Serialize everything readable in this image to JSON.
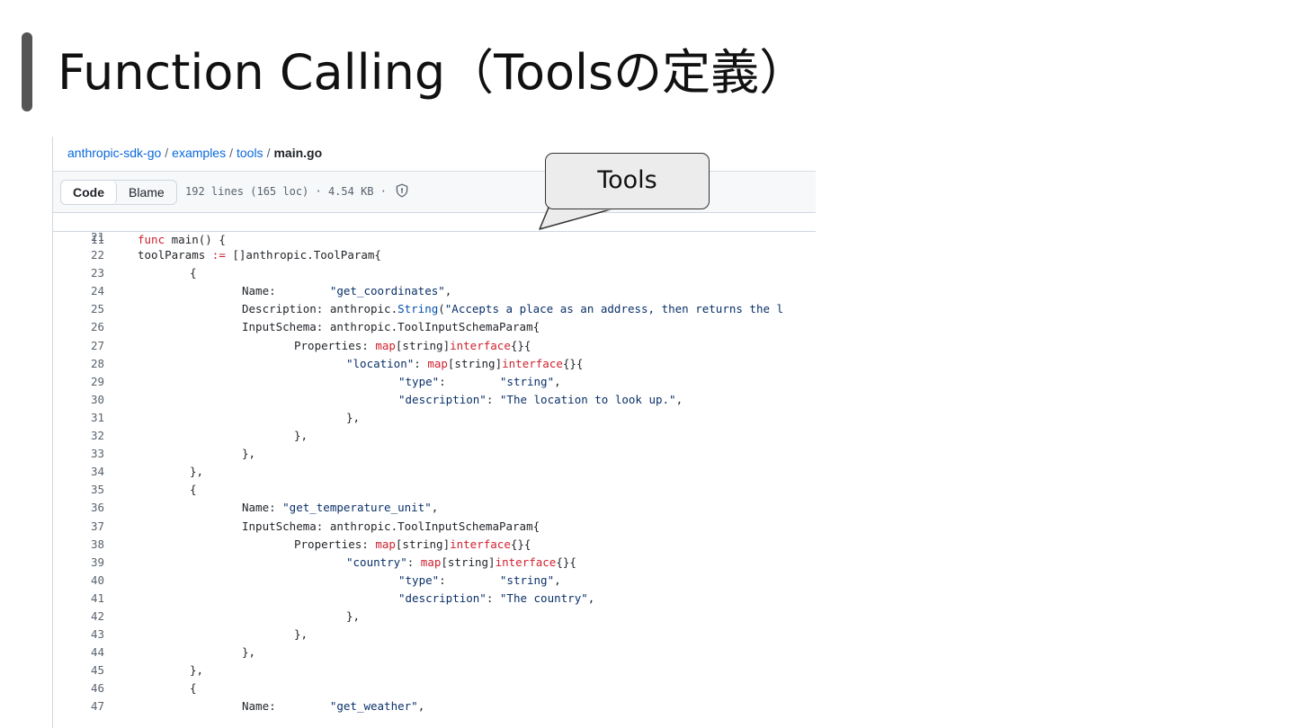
{
  "slide": {
    "title": "Function Calling（Toolsの定義）"
  },
  "callout": {
    "text": "Tools"
  },
  "breadcrumb": {
    "repo": "anthropic-sdk-go",
    "dir1": "examples",
    "dir2": "tools",
    "file": "main.go",
    "separator": "/"
  },
  "toolbar": {
    "code_label": "Code",
    "blame_label": "Blame",
    "file_meta": "192 lines (165 loc) · 4.54 KB ·",
    "shield_icon": "shield-icon"
  },
  "sticky": {
    "line": "11",
    "code": "func main() {"
  },
  "colors": {
    "link": "#0969da",
    "keyword": "#cf222e",
    "string": "#0a3069",
    "function": "#0550ae",
    "line_number": "#59636e",
    "accent_bar": "#555555"
  },
  "code_lines": [
    {
      "n": "21",
      "indent": 0,
      "tokens": []
    },
    {
      "n": "22",
      "indent": 1,
      "tokens": [
        [
          "t",
          "toolParams "
        ],
        [
          "k",
          ":="
        ],
        [
          "t",
          " []anthropic.ToolParam{"
        ]
      ]
    },
    {
      "n": "23",
      "indent": 2,
      "tokens": [
        [
          "t",
          "{"
        ]
      ]
    },
    {
      "n": "24",
      "indent": 3,
      "tokens": [
        [
          "t",
          "Name:        "
        ],
        [
          "s",
          "\"get_coordinates\""
        ],
        [
          "t",
          ","
        ]
      ]
    },
    {
      "n": "25",
      "indent": 3,
      "tokens": [
        [
          "t",
          "Description: anthropic."
        ],
        [
          "f",
          "String"
        ],
        [
          "t",
          "("
        ],
        [
          "s",
          "\"Accepts a place as an address, then returns the l"
        ]
      ]
    },
    {
      "n": "26",
      "indent": 3,
      "tokens": [
        [
          "t",
          "InputSchema: anthropic.ToolInputSchemaParam{"
        ]
      ]
    },
    {
      "n": "27",
      "indent": 4,
      "tokens": [
        [
          "t",
          "Properties: "
        ],
        [
          "k",
          "map"
        ],
        [
          "t",
          "[string]"
        ],
        [
          "k",
          "interface"
        ],
        [
          "t",
          "{}{"
        ]
      ]
    },
    {
      "n": "28",
      "indent": 5,
      "tokens": [
        [
          "s",
          "\"location\""
        ],
        [
          "t",
          ": "
        ],
        [
          "k",
          "map"
        ],
        [
          "t",
          "[string]"
        ],
        [
          "k",
          "interface"
        ],
        [
          "t",
          "{}{"
        ]
      ]
    },
    {
      "n": "29",
      "indent": 6,
      "tokens": [
        [
          "s",
          "\"type\""
        ],
        [
          "t",
          ":        "
        ],
        [
          "s",
          "\"string\""
        ],
        [
          "t",
          ","
        ]
      ]
    },
    {
      "n": "30",
      "indent": 6,
      "tokens": [
        [
          "s",
          "\"description\""
        ],
        [
          "t",
          ": "
        ],
        [
          "s",
          "\"The location to look up.\""
        ],
        [
          "t",
          ","
        ]
      ]
    },
    {
      "n": "31",
      "indent": 5,
      "tokens": [
        [
          "t",
          "},"
        ]
      ]
    },
    {
      "n": "32",
      "indent": 4,
      "tokens": [
        [
          "t",
          "},"
        ]
      ]
    },
    {
      "n": "33",
      "indent": 3,
      "tokens": [
        [
          "t",
          "},"
        ]
      ]
    },
    {
      "n": "34",
      "indent": 2,
      "tokens": [
        [
          "t",
          "},"
        ]
      ]
    },
    {
      "n": "35",
      "indent": 2,
      "tokens": [
        [
          "t",
          "{"
        ]
      ]
    },
    {
      "n": "36",
      "indent": 3,
      "tokens": [
        [
          "t",
          "Name: "
        ],
        [
          "s",
          "\"get_temperature_unit\""
        ],
        [
          "t",
          ","
        ]
      ]
    },
    {
      "n": "37",
      "indent": 3,
      "tokens": [
        [
          "t",
          "InputSchema: anthropic.ToolInputSchemaParam{"
        ]
      ]
    },
    {
      "n": "38",
      "indent": 4,
      "tokens": [
        [
          "t",
          "Properties: "
        ],
        [
          "k",
          "map"
        ],
        [
          "t",
          "[string]"
        ],
        [
          "k",
          "interface"
        ],
        [
          "t",
          "{}{"
        ]
      ]
    },
    {
      "n": "39",
      "indent": 5,
      "tokens": [
        [
          "s",
          "\"country\""
        ],
        [
          "t",
          ": "
        ],
        [
          "k",
          "map"
        ],
        [
          "t",
          "[string]"
        ],
        [
          "k",
          "interface"
        ],
        [
          "t",
          "{}{"
        ]
      ]
    },
    {
      "n": "40",
      "indent": 6,
      "tokens": [
        [
          "s",
          "\"type\""
        ],
        [
          "t",
          ":        "
        ],
        [
          "s",
          "\"string\""
        ],
        [
          "t",
          ","
        ]
      ]
    },
    {
      "n": "41",
      "indent": 6,
      "tokens": [
        [
          "s",
          "\"description\""
        ],
        [
          "t",
          ": "
        ],
        [
          "s",
          "\"The country\""
        ],
        [
          "t",
          ","
        ]
      ]
    },
    {
      "n": "42",
      "indent": 5,
      "tokens": [
        [
          "t",
          "},"
        ]
      ]
    },
    {
      "n": "43",
      "indent": 4,
      "tokens": [
        [
          "t",
          "},"
        ]
      ]
    },
    {
      "n": "44",
      "indent": 3,
      "tokens": [
        [
          "t",
          "},"
        ]
      ]
    },
    {
      "n": "45",
      "indent": 2,
      "tokens": [
        [
          "t",
          "},"
        ]
      ]
    },
    {
      "n": "46",
      "indent": 2,
      "tokens": [
        [
          "t",
          "{"
        ]
      ]
    },
    {
      "n": "47",
      "indent": 3,
      "tokens": [
        [
          "t",
          "Name:        "
        ],
        [
          "s",
          "\"get_weather\""
        ],
        [
          "t",
          ","
        ]
      ]
    }
  ]
}
